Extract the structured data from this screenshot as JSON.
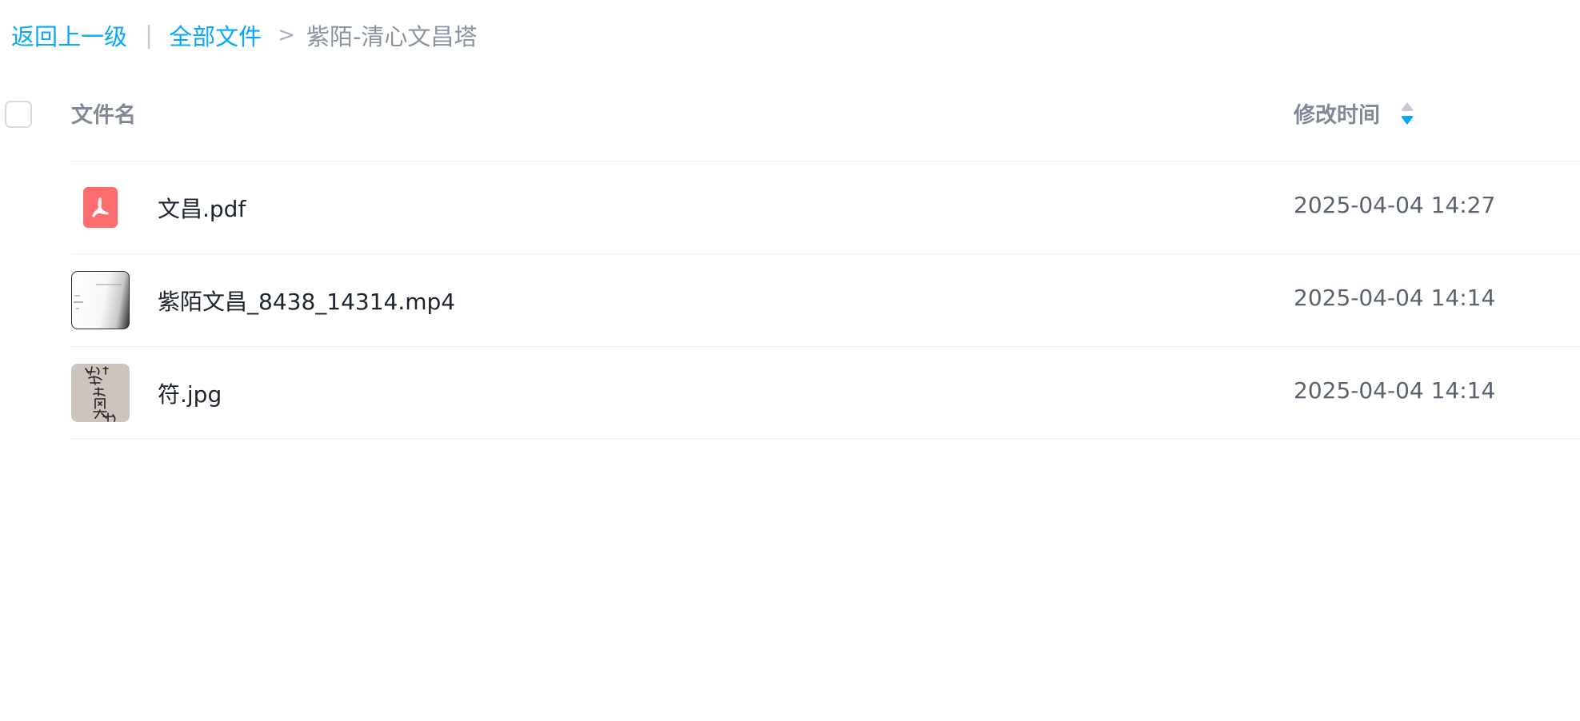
{
  "breadcrumb": {
    "back_label": "返回上一级",
    "divider": "|",
    "root_label": "全部文件",
    "separator": ">",
    "current_label": "紫陌-清心文昌塔"
  },
  "table": {
    "columns": {
      "name": "文件名",
      "modified": "修改时间"
    },
    "sort": {
      "icon": "sort-desc-icon",
      "active_color": "#06a7ff",
      "inactive_color": "#c4cbd8"
    },
    "rows": [
      {
        "name": "文昌.pdf",
        "modified": "2025-04-04 14:27",
        "icon": "pdf-file-icon",
        "icon_color": "#fe6c70"
      },
      {
        "name": "紫陌文昌_8438_14314.mp4",
        "modified": "2025-04-04 14:14",
        "icon": "video-thumbnail"
      },
      {
        "name": "符.jpg",
        "modified": "2025-04-04 14:14",
        "icon": "image-thumbnail"
      }
    ]
  }
}
